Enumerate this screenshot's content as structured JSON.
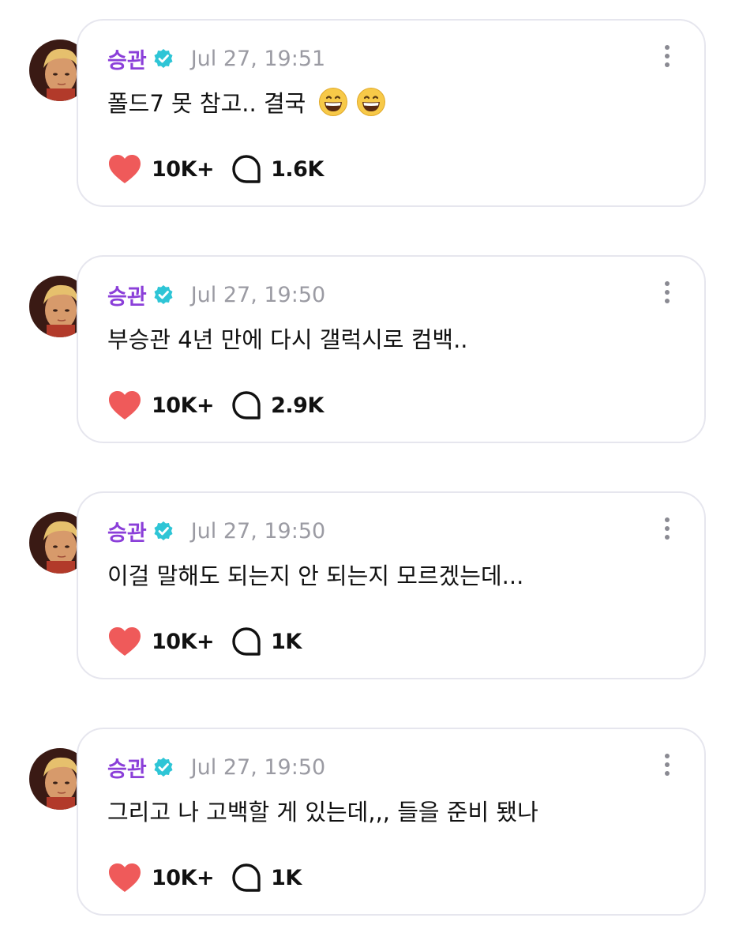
{
  "posts": [
    {
      "author": "승관",
      "time": "Jul 27, 19:51",
      "text": "폴드7 못 참고.. 결국",
      "emojis": [
        "grinning-face",
        "grinning-face"
      ],
      "likes": "10K+",
      "comments": "1.6K"
    },
    {
      "author": "승관",
      "time": "Jul 27, 19:50",
      "text": "부승관 4년 만에 다시 갤럭시로 컴백..",
      "emojis": [],
      "likes": "10K+",
      "comments": "2.9K"
    },
    {
      "author": "승관",
      "time": "Jul 27, 19:50",
      "text": "이걸 말해도 되는지 안 되는지 모르겠는데...",
      "emojis": [],
      "likes": "10K+",
      "comments": "1K"
    },
    {
      "author": "승관",
      "time": "Jul 27, 19:50",
      "text": "그리고 나 고백할 게 있는데,,, 들을 준비 됐나",
      "emojis": [],
      "likes": "10K+",
      "comments": "1K"
    }
  ],
  "icons": {
    "verified": "verified-badge-icon",
    "like": "heart-icon",
    "comment": "comment-bubble-icon",
    "more": "more-vertical-icon"
  },
  "colors": {
    "author": "#8b3fd9",
    "verified": "#2ec5d6",
    "heart": "#ef5a5a",
    "timestamp": "#9b9ba3",
    "card_border": "#e6e6ee"
  }
}
